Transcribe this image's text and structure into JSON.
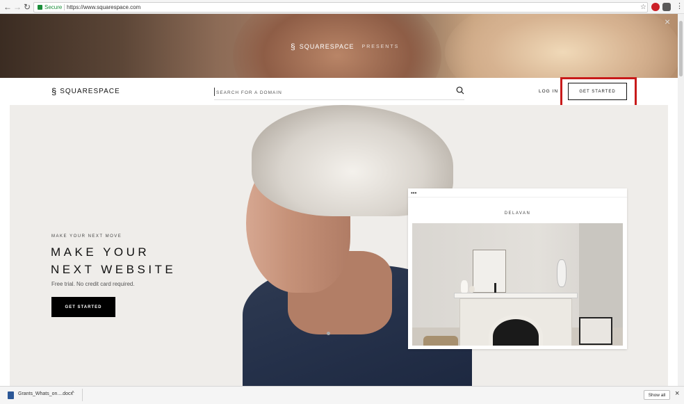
{
  "browser": {
    "secure_label": "Secure",
    "url": "https://www.squarespace.com",
    "back_icon": "←",
    "forward_icon": "→",
    "reload_icon": "↻",
    "star_icon": "☆",
    "menu_icon": "⋮"
  },
  "banner": {
    "brand": "SQUARESPACE",
    "presents": "PRESENTS",
    "close_icon": "×"
  },
  "nav": {
    "brand": "SQUARESPACE",
    "search_placeholder": "SEARCH FOR A DOMAIN",
    "login": "LOG IN",
    "get_started": "GET STARTED"
  },
  "hero": {
    "eyebrow": "MAKE YOUR NEXT MOVE",
    "headline_line1": "MAKE YOUR",
    "headline_line2": "NEXT WEBSITE",
    "subtext": "Free trial. No credit card required.",
    "cta": "GET STARTED"
  },
  "template_preview": {
    "dots": "•••",
    "title": "DELAVAN"
  },
  "downloads": {
    "file_name": "Grants_Whats_on....docx",
    "chevron": "^",
    "show_all": "Show all",
    "close_icon": "×"
  },
  "colors": {
    "highlight": "#c81a1a",
    "cta_bg": "#000000",
    "secure": "#1a8e3a"
  }
}
